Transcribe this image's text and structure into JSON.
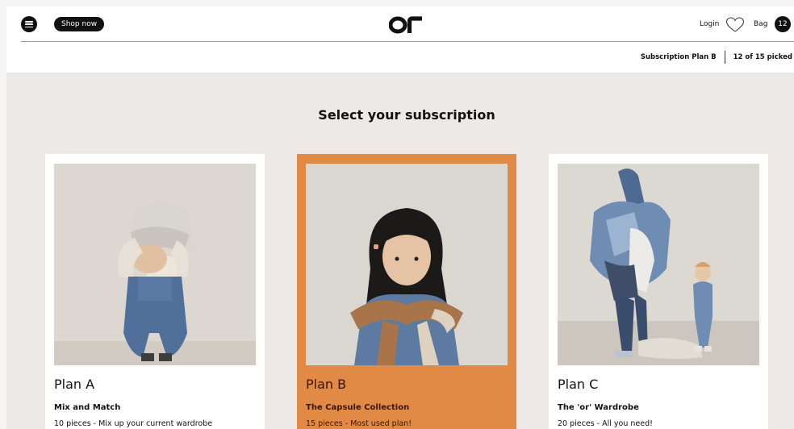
{
  "header": {
    "menu_icon": "menu-icon",
    "shop_label": "Shop now",
    "logo_text": "or",
    "login_label": "Login",
    "wishlist_icon": "heart-icon",
    "bag_label": "Bag",
    "bag_count": "12"
  },
  "subscription_status": {
    "plan": "Subscription Plan B",
    "picked": "12 of 15 picked"
  },
  "main": {
    "heading": "Select your subscription",
    "plans": [
      {
        "name": "Plan A",
        "subtitle": "Mix and Match",
        "description": "10 pieces - Mix up your current wardrobe",
        "selected": false
      },
      {
        "name": "Plan B",
        "subtitle": "The Capsule Collection",
        "description": "15 pieces - Most used plan!",
        "selected": true
      },
      {
        "name": "Plan C",
        "subtitle": "The 'or' Wardrobe",
        "description": "20 pieces - All you need!",
        "selected": false
      }
    ]
  },
  "colors": {
    "accent": "#e08a46",
    "background": "#ece9e7",
    "text": "#111111"
  }
}
